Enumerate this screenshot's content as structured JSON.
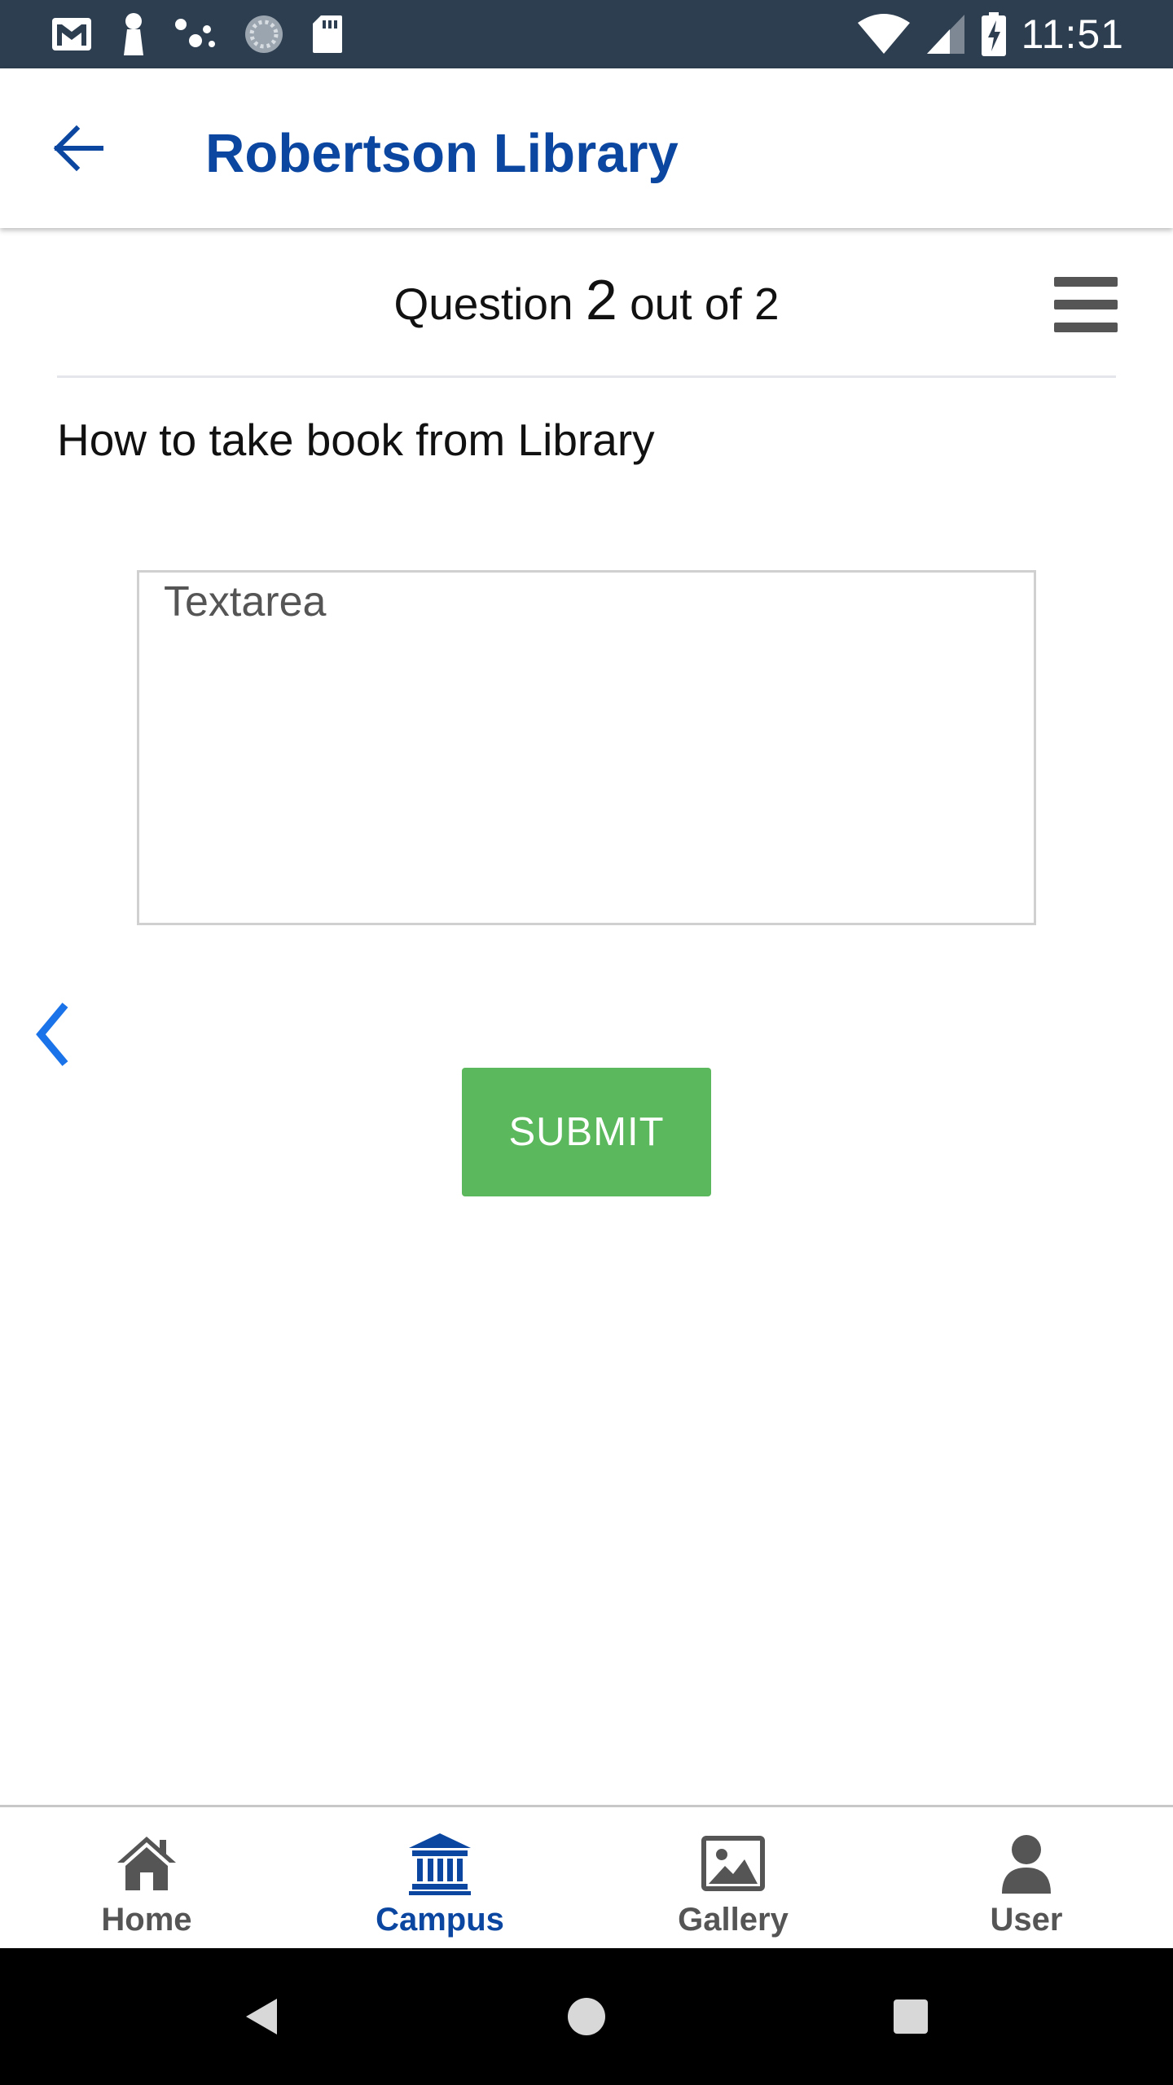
{
  "status_bar": {
    "time": "11:51",
    "left_icons": [
      "gmail-icon",
      "keyhole-icon",
      "dots-icon",
      "sync-icon",
      "sd-card-icon"
    ],
    "right_icons": [
      "wifi-icon",
      "signal-icon",
      "battery-charging-icon"
    ]
  },
  "app_bar": {
    "back_icon": "arrow-left-icon",
    "title": "Robertson Library"
  },
  "question": {
    "prefix": "Question",
    "current": "2",
    "suffix": "out of 2",
    "text": "How to take book from Library",
    "menu_icon": "hamburger-icon"
  },
  "answer": {
    "placeholder": "Textarea",
    "value": ""
  },
  "actions": {
    "prev_icon": "chevron-left-icon",
    "submit_label": "SUBMIT"
  },
  "bottom_nav": {
    "items": [
      {
        "label": "Home",
        "icon": "home-icon",
        "active": false
      },
      {
        "label": "Campus",
        "icon": "campus-icon",
        "active": true
      },
      {
        "label": "Gallery",
        "icon": "gallery-icon",
        "active": false
      },
      {
        "label": "User",
        "icon": "user-icon",
        "active": false
      }
    ]
  },
  "system_nav": [
    "back-triangle-icon",
    "home-circle-icon",
    "recents-square-icon"
  ],
  "colors": {
    "status_bar": "#2d3e50",
    "accent": "#0b47a1",
    "submit": "#5cb85c",
    "prev_chevron": "#1a73e8"
  }
}
